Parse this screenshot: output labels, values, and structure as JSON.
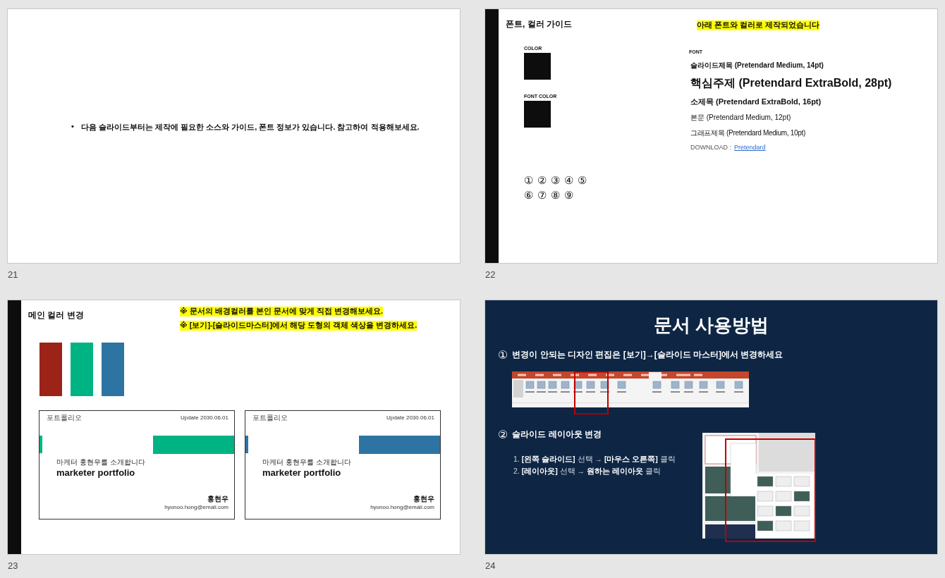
{
  "slides": [
    {
      "number": "21",
      "kind": "bullet",
      "bullet": "•",
      "text": "다음 슬라이드부터는 제작에  필요한 소스와 가이드, 폰트 정보가 있습니다. 참고하여 적용해보세요."
    },
    {
      "number": "22",
      "kind": "guide",
      "title": "폰트, 컬러 가이드",
      "note": "아래 폰트와 컬러로 제작되었습니다",
      "swatches": [
        {
          "label": "COLOR",
          "color": "#0d0d0d"
        },
        {
          "label": "FONT COLOR",
          "color": "#0d0d0d"
        }
      ],
      "circled_numbers": [
        [
          "①",
          "②",
          "③",
          "④",
          "⑤"
        ],
        [
          "⑥",
          "⑦",
          "⑧",
          "⑨"
        ]
      ],
      "font_heading": "FONT",
      "font_samples": [
        {
          "kind": "slide-title",
          "text": "슬라이드제목 (Pretendard Medium, 14pt)"
        },
        {
          "kind": "key-topic",
          "text": "핵심주제 (Pretendard ExtraBold, 28pt)"
        },
        {
          "kind": "subtitle",
          "text": "소제목 (Pretendard ExtraBold, 16pt)"
        },
        {
          "kind": "body",
          "text": "본문 (Pretendard Medium, 12pt)"
        },
        {
          "kind": "graph-title",
          "text": "그래프제목 (Pretendard Medium, 10pt)"
        }
      ],
      "download_label": "DOWNLOAD :",
      "download_link": "Pretendard"
    },
    {
      "number": "23",
      "kind": "colors",
      "title": "메인 컬러 변경",
      "notes": [
        "※ 문서의 배경컬러를 본인 문서에 맞게 직접 변경해보세요.",
        "※ [보기]-[슬라이드마스터]에서 해당 도형의 객체 색상을 변경하세요."
      ],
      "bars": [
        {
          "color": "#9b2318"
        },
        {
          "color": "#00b383"
        },
        {
          "color": "#2e74a3"
        }
      ],
      "cards": [
        {
          "color": "#00b383",
          "label": "포트폴리오",
          "date": "Update 2030.06.01",
          "subtitle": "마케터 홍현우를 소개합니다",
          "title": "marketer portfolio",
          "name": "홍현우",
          "email": "hyunoo.hong@email.com"
        },
        {
          "color": "#2e74a3",
          "label": "포트폴리오",
          "date": "Update 2030.06.01",
          "subtitle": "마케터 홍현우를 소개합니다",
          "title": "marketer portfolio",
          "name": "홍현우",
          "email": "hyunoo.hong@email.com"
        }
      ]
    },
    {
      "number": "24",
      "kind": "howto",
      "title": "문서 사용방법",
      "steps": [
        {
          "mark": "①",
          "text": "변경이 안되는 디자인 편집은 [보기]→[슬라이드 마스터]에서 변경하세요"
        },
        {
          "mark": "②",
          "text": "슬라이드 레이아웃 변경"
        }
      ],
      "list": [
        "1. **[왼쪽 슬라이드]** 선택 → **[마우스 오른쪽]** 클릭",
        "2. **[레이아웃]** 선택 → **원하는 레이아웃** 클릭"
      ]
    }
  ]
}
